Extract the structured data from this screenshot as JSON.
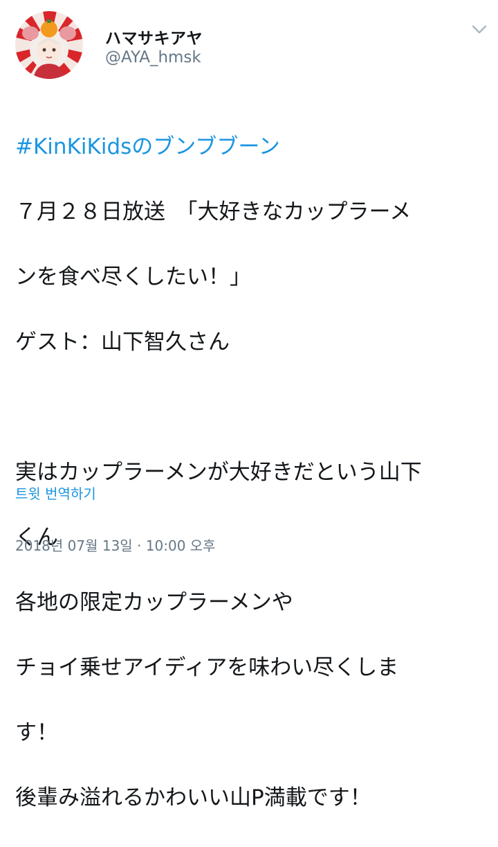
{
  "user": {
    "display_name": "ハマサキアヤ",
    "handle": "@AYA_hmsk"
  },
  "tweet": {
    "hashtag": "#KinKiKidsのブンブブーン",
    "lines": [
      "７月２８日放送　「大好きなカップラーメ",
      "ンを食べ尽くしたい！」",
      "ゲスト：山下智久さん",
      "",
      "実はカップラーメンが大好きだという山下",
      "くん",
      "各地の限定カップラーメンや",
      "チョイ乗せアイディアを味わい尽くしま",
      "す！",
      "後輩み溢れるかわいい山P満載です！"
    ],
    "translate_label": "트윗 번역하기",
    "timestamp": "2018년 07월 13일 · 10:00 오후"
  },
  "icons": {
    "menu": "chevron-down-icon",
    "avatar": "avatar"
  },
  "colors": {
    "link": "#1b95e0",
    "secondary": "#657786",
    "text": "#14171a"
  }
}
